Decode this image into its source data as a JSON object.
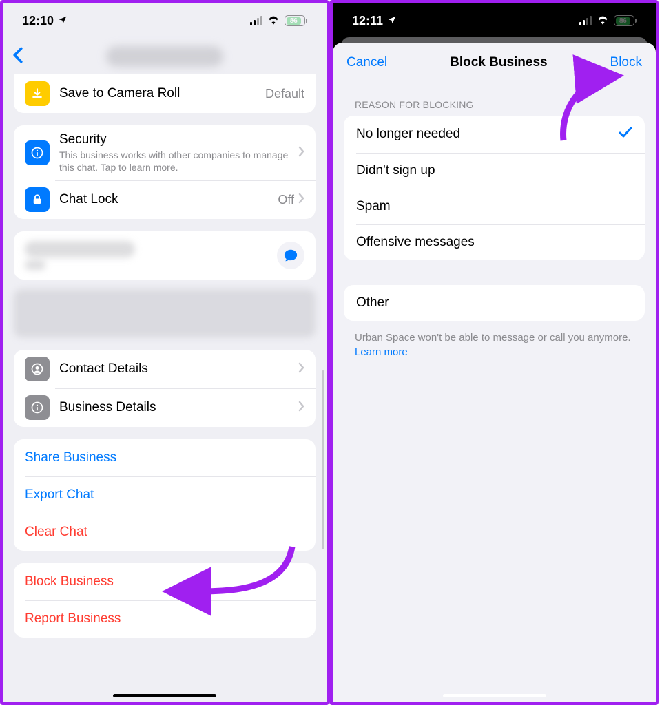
{
  "left": {
    "status": {
      "time": "12:10",
      "battery": "86"
    },
    "rows": {
      "save_camera": {
        "title": "Save to Camera Roll",
        "trail": "Default"
      },
      "security": {
        "title": "Security",
        "sub": "This business works with other companies to manage this chat. Tap to learn more."
      },
      "chat_lock": {
        "title": "Chat Lock",
        "trail": "Off"
      },
      "contact_details": "Contact Details",
      "business_details": "Business Details"
    },
    "actions": {
      "share": "Share Business",
      "export": "Export Chat",
      "clear": "Clear Chat",
      "block": "Block Business",
      "report": "Report Business"
    }
  },
  "right": {
    "status": {
      "time": "12:11",
      "battery": "86"
    },
    "nav": {
      "cancel": "Cancel",
      "title": "Block Business",
      "block": "Block"
    },
    "section_header": "REASON FOR BLOCKING",
    "reasons": {
      "r1": "No longer needed",
      "r2": "Didn't sign up",
      "r3": "Spam",
      "r4": "Offensive messages",
      "other": "Other"
    },
    "footer": {
      "text": "Urban Space won't be able to message or call you anymore. ",
      "link": "Learn more"
    }
  }
}
